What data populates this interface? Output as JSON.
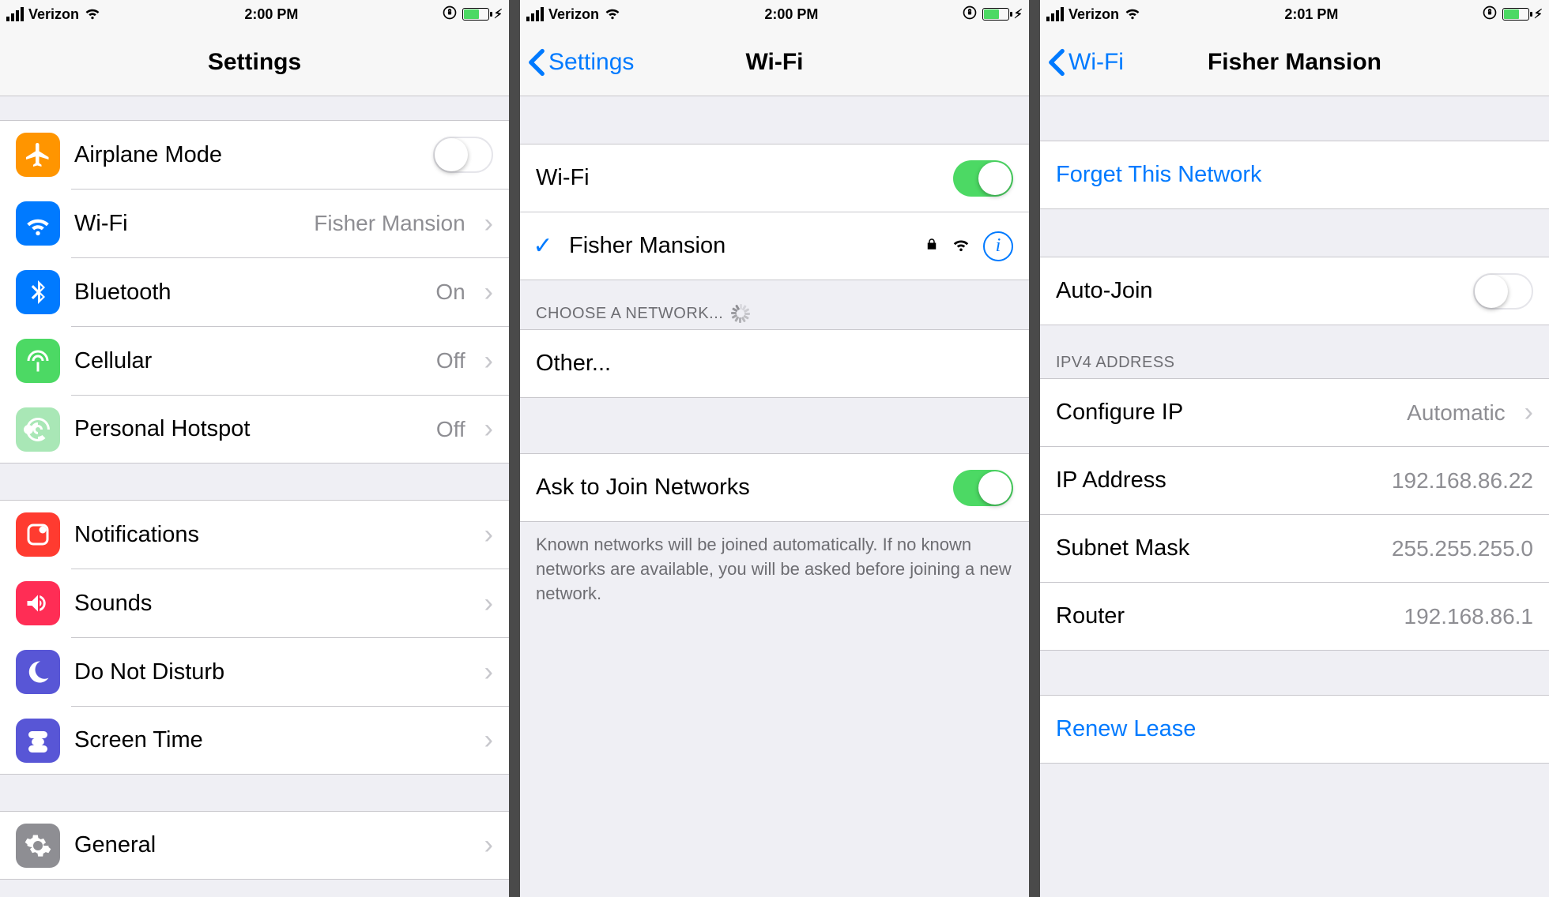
{
  "status": {
    "carrier": "Verizon",
    "time_a": "2:00 PM",
    "time_b": "2:00 PM",
    "time_c": "2:01 PM"
  },
  "screen1": {
    "title": "Settings",
    "items_a": [
      {
        "name": "Airplane Mode",
        "toggle": false
      },
      {
        "name": "Wi-Fi",
        "value": "Fisher Mansion"
      },
      {
        "name": "Bluetooth",
        "value": "On"
      },
      {
        "name": "Cellular",
        "value": "Off"
      },
      {
        "name": "Personal Hotspot",
        "value": "Off"
      }
    ],
    "items_b": [
      {
        "name": "Notifications"
      },
      {
        "name": "Sounds"
      },
      {
        "name": "Do Not Disturb"
      },
      {
        "name": "Screen Time"
      }
    ],
    "items_c": [
      {
        "name": "General"
      }
    ]
  },
  "screen2": {
    "back": "Settings",
    "title": "Wi-Fi",
    "wifi_label": "Wi-Fi",
    "wifi_on": true,
    "connected": "Fisher Mansion",
    "choose_header": "CHOOSE A NETWORK...",
    "other": "Other...",
    "ask_label": "Ask to Join Networks",
    "ask_on": true,
    "ask_footer": "Known networks will be joined automatically. If no known networks are available, you will be asked before joining a new network."
  },
  "screen3": {
    "back": "Wi-Fi",
    "title": "Fisher Mansion",
    "forget": "Forget This Network",
    "autojoin_label": "Auto-Join",
    "autojoin_on": false,
    "ipv4_header": "IPV4 ADDRESS",
    "configure_ip_label": "Configure IP",
    "configure_ip_value": "Automatic",
    "ip_label": "IP Address",
    "ip_value": "192.168.86.22",
    "subnet_label": "Subnet Mask",
    "subnet_value": "255.255.255.0",
    "router_label": "Router",
    "router_value": "192.168.86.1",
    "renew": "Renew Lease"
  }
}
